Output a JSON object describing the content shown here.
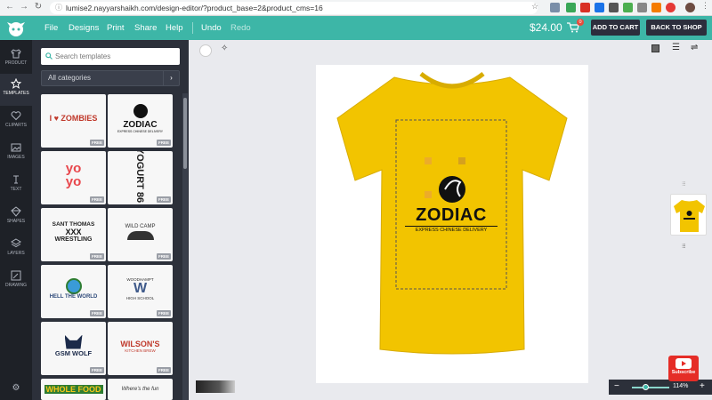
{
  "browser": {
    "url": "lumise2.nayyarshaikh.com/design-editor/?product_base=2&product_cms=16"
  },
  "appbar": {
    "menu": [
      "File",
      "Designs",
      "Print",
      "Share",
      "Help"
    ],
    "undo": "Undo",
    "redo": "Redo",
    "price": "$24.00",
    "cart_count": "0",
    "add_to_cart": "ADD TO CART",
    "back_to_shop": "BACK TO SHOP"
  },
  "rail": [
    "PRODUCT",
    "TEMPLATES",
    "CLIPARTS",
    "IMAGES",
    "TEXT",
    "SHAPES",
    "LAYERS",
    "DRAWING"
  ],
  "panel": {
    "search_placeholder": "Search templates",
    "category": "All categories",
    "free_label": "FREE",
    "templates": [
      {
        "title": "I ♥ ZOMBIES"
      },
      {
        "title": "ZODIAC",
        "sub": "EXPRESS CHINESE DELIVERY"
      },
      {
        "title": "yo yo"
      },
      {
        "title": "YOGURT 86"
      },
      {
        "title": "SANT THOMAS",
        "mid": "XXX",
        "sub": "WRESTLING"
      },
      {
        "title": "WILD CAMP"
      },
      {
        "title": "HELL THE WORLD"
      },
      {
        "title": "W",
        "top": "WOODHAMPT",
        "sub": "HIGH SCHOOL"
      },
      {
        "title": "GSM WOLF"
      },
      {
        "title": "WILSON'S",
        "sub": "KITCHEN BREW"
      },
      {
        "title": "WHOLE FOOD"
      },
      {
        "title": "Where's the fun"
      }
    ]
  },
  "design": {
    "title": "ZODIAC",
    "sub": "EXPRESS CHINESE DELIVERY"
  },
  "zoom": "114%",
  "subscribe": "Subscribe",
  "colors": {
    "accent": "#3db6a7",
    "dark": "#2c2e3c",
    "shirt": "#f2c400"
  }
}
